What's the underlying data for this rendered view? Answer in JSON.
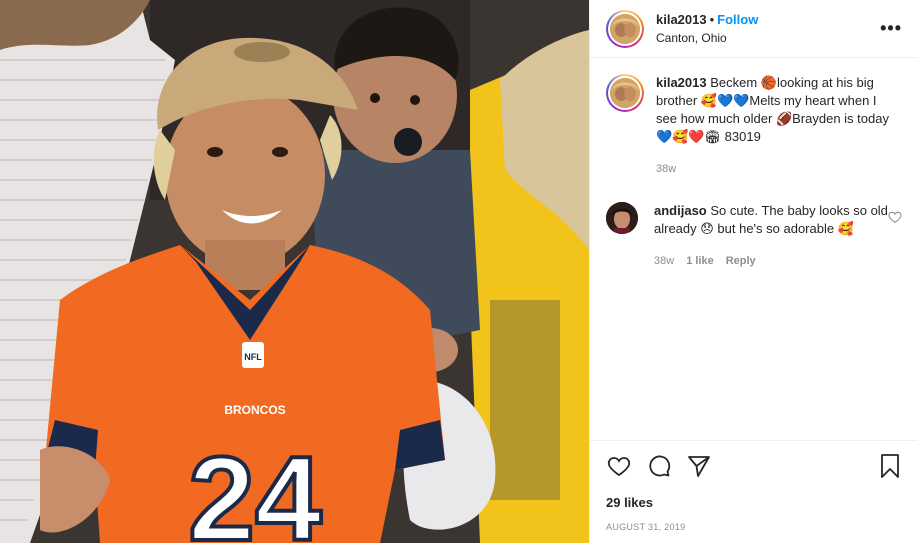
{
  "post": {
    "author": "kila2013",
    "separator": "•",
    "follow_label": "Follow",
    "location": "Canton, Ohio",
    "more_label": "•••"
  },
  "caption": {
    "username": "kila2013",
    "text": "Beckem 🏀looking at his big brother 🥰💙💙Melts my heart when I see how much older 🏈Brayden is today 💙🥰❤️🏟 83019",
    "time": "38w"
  },
  "comments": [
    {
      "username": "andijaso",
      "text": "So cute. The baby looks so old already 😞 but he's so adorable 🥰",
      "time": "38w",
      "likes": "1 like",
      "reply_label": "Reply"
    }
  ],
  "actions": {
    "likes": "29 likes",
    "date": "AUGUST 31, 2019"
  },
  "photo": {
    "jersey_number": "24",
    "jersey_brand": "BRONCOS",
    "colors": {
      "jersey": "#f26a21",
      "collar": "#1b2a4a",
      "cap": "#c9a97a",
      "background": "#3a3430",
      "yellow_shirt": "#f2c31a"
    }
  },
  "icons": [
    "heart-icon",
    "comment-icon",
    "share-icon",
    "bookmark-icon",
    "more-icon"
  ]
}
